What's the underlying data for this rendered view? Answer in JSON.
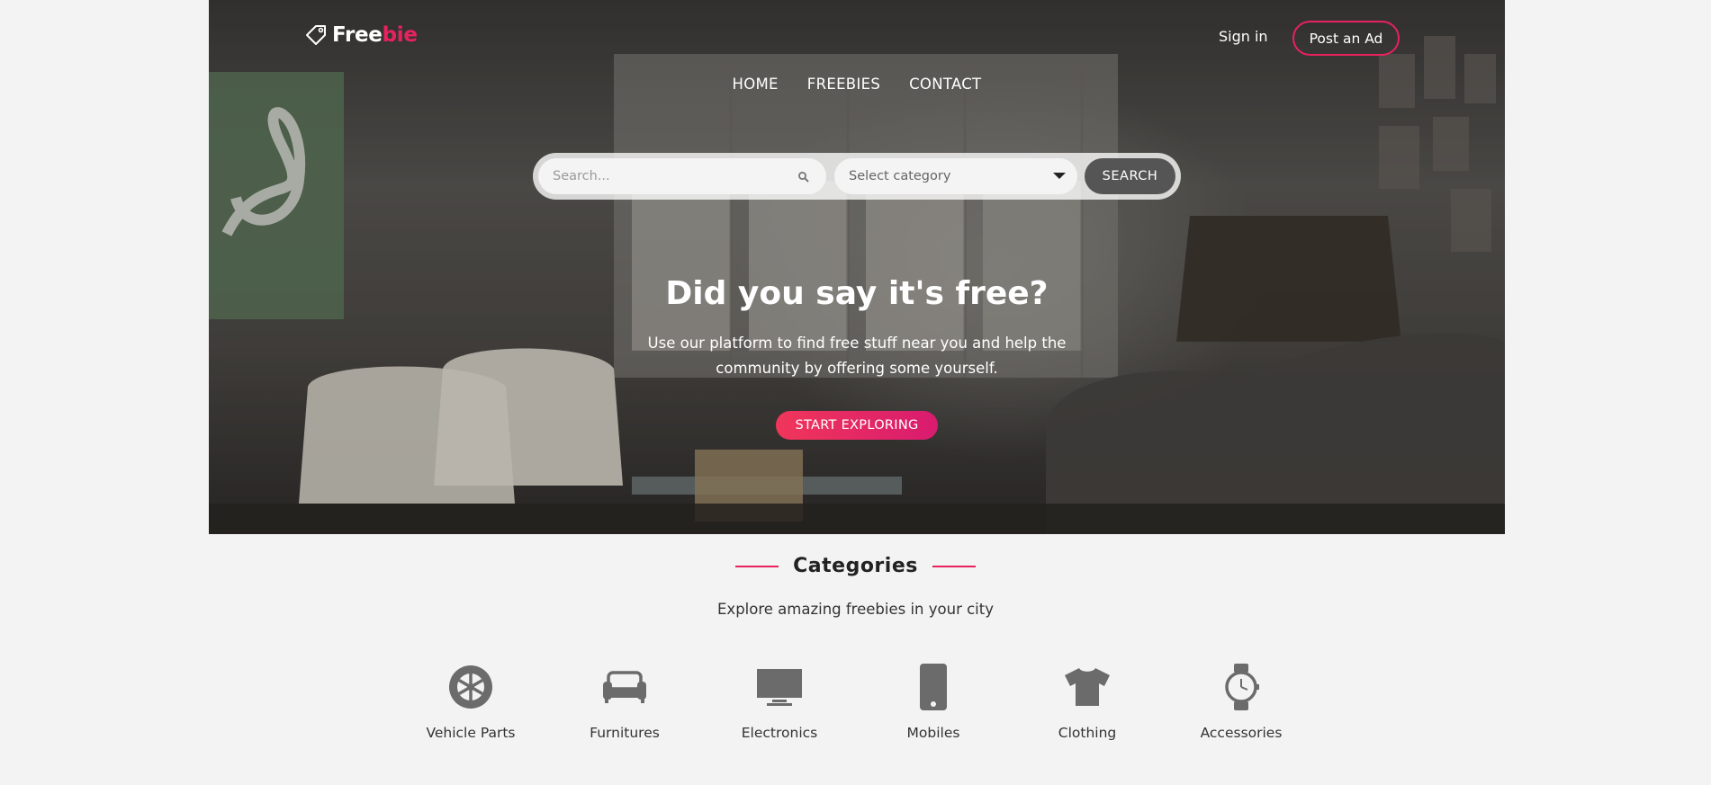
{
  "brand": {
    "logo_white": "Free",
    "logo_pink": "bie"
  },
  "header": {
    "sign_in": "Sign in",
    "post_ad": "Post an Ad"
  },
  "nav": {
    "items": [
      {
        "label": "HOME"
      },
      {
        "label": "FREEBIES"
      },
      {
        "label": "CONTACT"
      }
    ]
  },
  "search": {
    "placeholder": "Search...",
    "category_selected": "Select category",
    "button": "SEARCH"
  },
  "hero": {
    "title": "Did you say it's free?",
    "subtitle": "Use our platform to find free stuff near you and help the community by offering some yourself.",
    "cta": "START EXPLORING"
  },
  "categories": {
    "title": "Categories",
    "subtitle": "Explore amazing freebies in your city",
    "items": [
      {
        "label": "Vehicle Parts",
        "icon": "wheel-icon"
      },
      {
        "label": "Furnitures",
        "icon": "sofa-icon"
      },
      {
        "label": "Electronics",
        "icon": "monitor-icon"
      },
      {
        "label": "Mobiles",
        "icon": "mobile-phone-icon"
      },
      {
        "label": "Clothing",
        "icon": "tshirt-icon"
      },
      {
        "label": "Accessories",
        "icon": "watch-icon"
      }
    ]
  },
  "colors": {
    "accent": "#e8215f",
    "search_button": "#555555",
    "page_background": "#f3f3f3",
    "icon_gray": "#6b6b6b"
  }
}
